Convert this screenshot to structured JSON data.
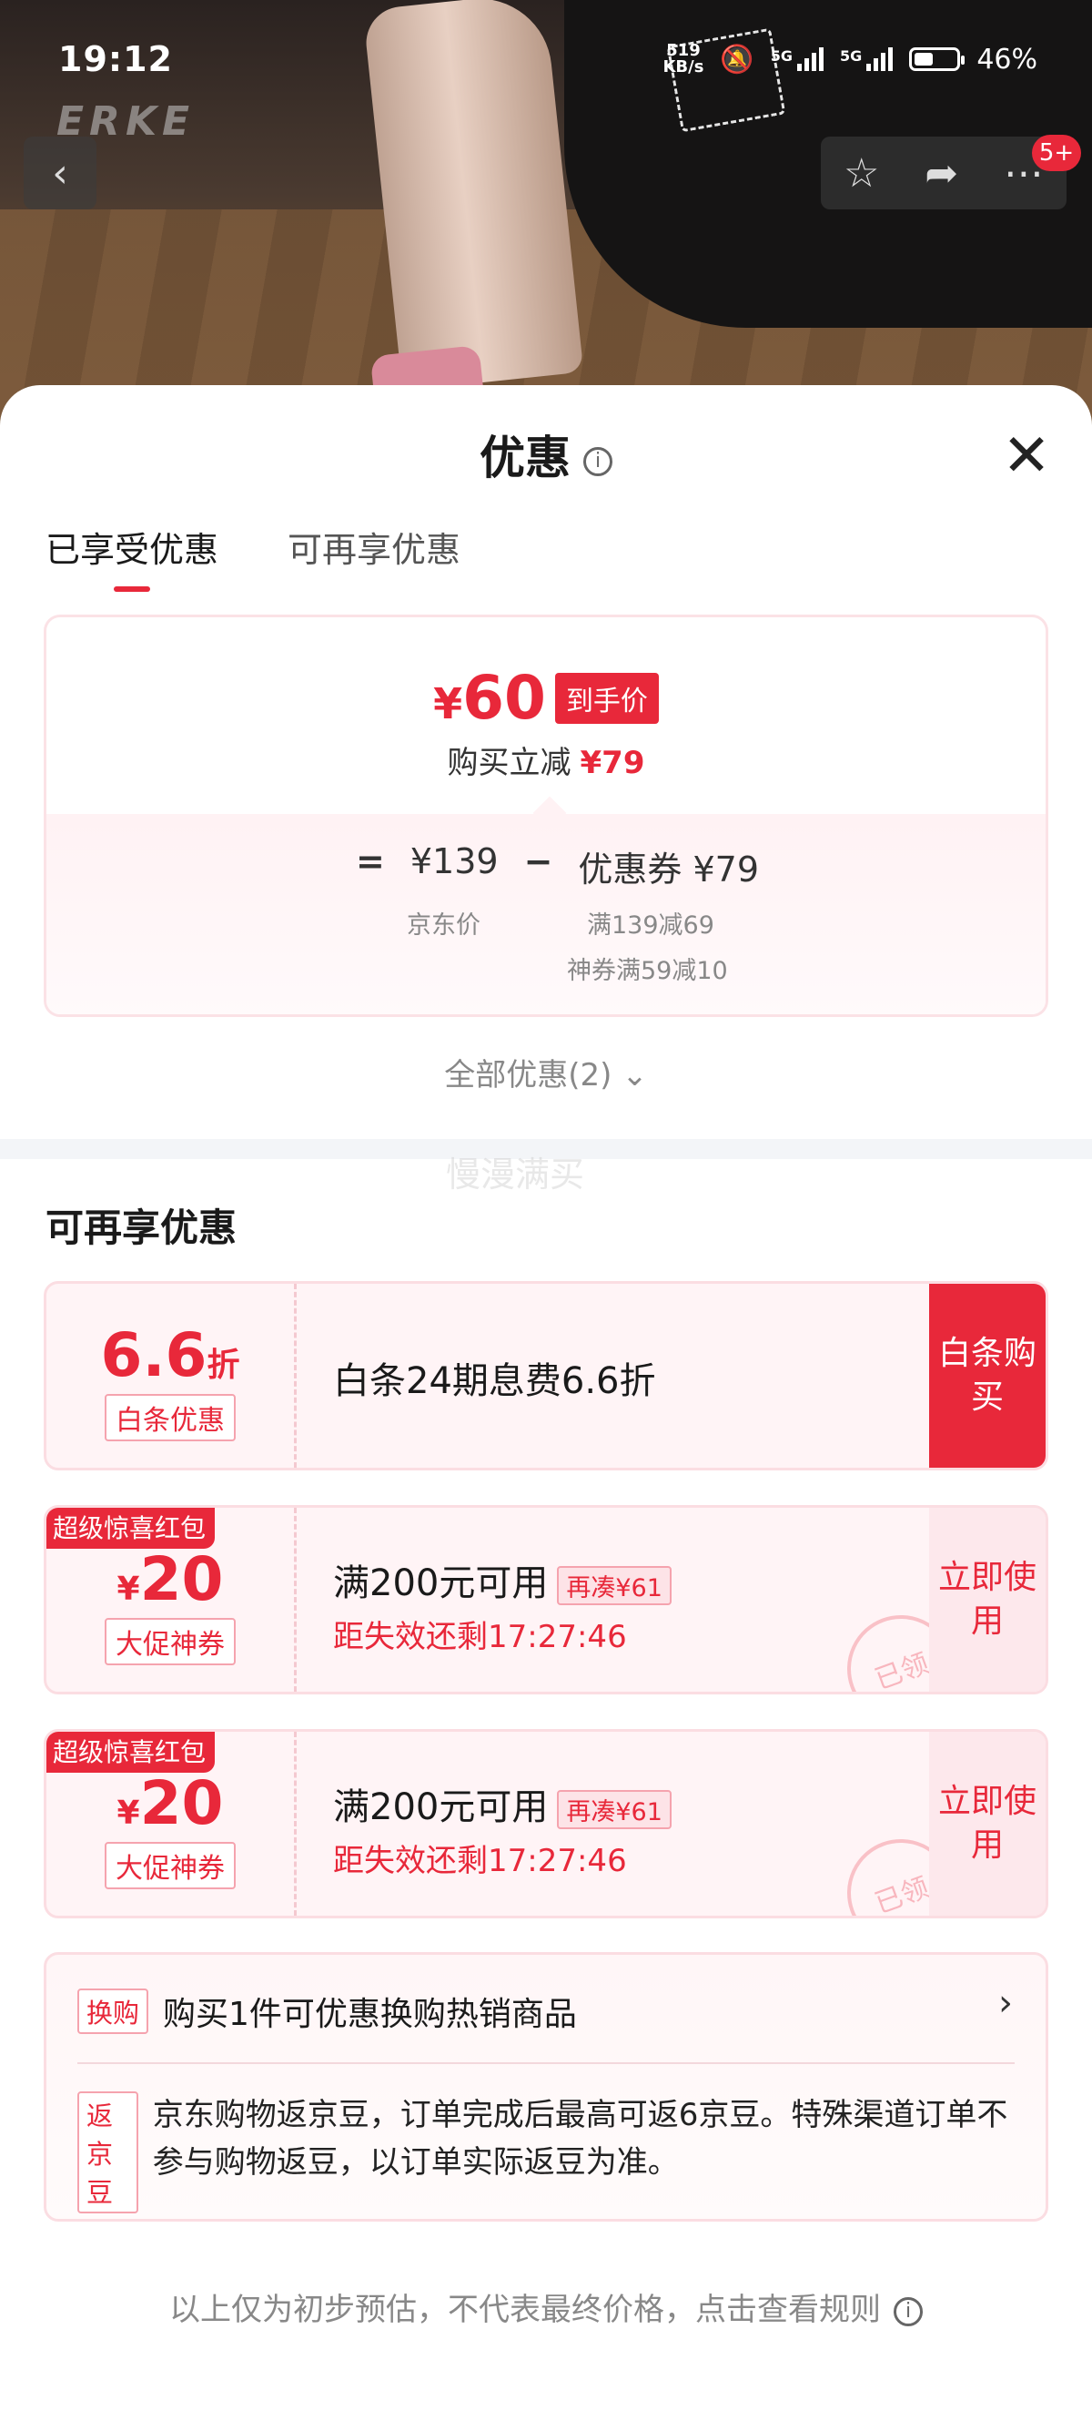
{
  "status_bar": {
    "time": "19:12",
    "net_speed_value": "519",
    "net_speed_unit": "KB/s",
    "sim1": "5G",
    "sim2": "5G",
    "battery": "46%"
  },
  "product_header": {
    "brand_logo_text": "ERKE",
    "cart_badge": "5+"
  },
  "sheet": {
    "title": "优惠",
    "tabs": [
      {
        "label": "已享受优惠",
        "active": true
      },
      {
        "label": "可再享优惠",
        "active": false
      }
    ],
    "final_price": {
      "currency": "¥",
      "amount": "60",
      "tag": "到手价",
      "discount_label": "购买立减",
      "discount_amount": "¥79"
    },
    "breakdown": {
      "equals": "=",
      "base_price": "¥139",
      "base_label": "京东价",
      "minus": "−",
      "coupon_total": "优惠券 ¥79",
      "coupon_detail_1": "满139减69",
      "coupon_detail_2": "神券满59减10"
    },
    "all_offers_link": "全部优惠(2)",
    "watermark": "慢漫满买"
  },
  "more_offers": {
    "title": "可再享优惠",
    "coupons": [
      {
        "value": "6.6",
        "unit": "折",
        "kind": "白条优惠",
        "desc": "白条24期息费6.6折",
        "action": "白条购买"
      },
      {
        "ribbon": "超级惊喜红包",
        "currency": "¥",
        "value": "20",
        "kind": "大促神券",
        "desc": "满200元可用",
        "need_more": "再凑¥61",
        "countdown": "距失效还剩17:27:46",
        "action": "立即使用",
        "stamp": "已领"
      },
      {
        "ribbon": "超级惊喜红包",
        "currency": "¥",
        "value": "20",
        "kind": "大促神券",
        "desc": "满200元可用",
        "need_more": "再凑¥61",
        "countdown": "距失效还剩17:27:46",
        "action": "立即使用",
        "stamp": "已领"
      }
    ],
    "exchange": {
      "tag": "换购",
      "text": "购买1件可优惠换购热销商品"
    },
    "beans": {
      "tag": "返京豆",
      "text": "京东购物返京豆，订单完成后最高可返6京豆。特殊渠道订单不参与购物返豆，以订单实际返豆为准。"
    }
  },
  "footnote": "以上仅为初步预估，不代表最终价格，点击查看规则",
  "colors": {
    "accent": "#e8283a",
    "card_border": "#fbdde2",
    "card_bg": "#fff4f6"
  }
}
